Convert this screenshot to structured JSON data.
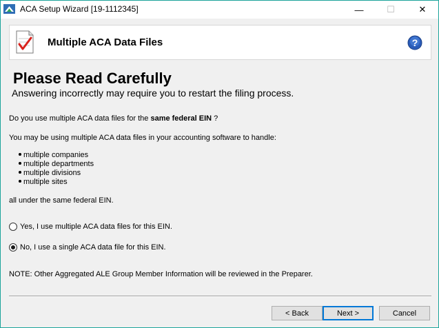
{
  "window": {
    "title": "ACA Setup Wizard [19-1112345]",
    "minimize": "—",
    "maximize": "☐",
    "close": "✕",
    "accent_color": "#1aa39a"
  },
  "header": {
    "title": "Multiple ACA Data Files",
    "icon": "checklist-icon",
    "help_icon": "help-icon"
  },
  "content": {
    "heading": "Please Read Carefully",
    "subheading": "Answering incorrectly may require you to restart the filing process.",
    "question_prefix": "Do you use multiple ACA data files for the",
    "question_bold": "same federal EIN",
    "question_suffix": "?",
    "intro": "You may be using multiple ACA data files in your accounting software to handle:",
    "list": [
      "multiple companies",
      "multiple departments",
      "multiple divisions",
      "multiple sites"
    ],
    "closing": "all under the same federal EIN.",
    "options": [
      {
        "label": "Yes, I use multiple ACA data files for this EIN.",
        "selected": false
      },
      {
        "label": "No, I use a single ACA data file for this EIN.",
        "selected": true
      }
    ],
    "note": "NOTE: Other Aggregated ALE Group Member Information will be reviewed in the Preparer."
  },
  "footer": {
    "back_label": "< Back",
    "next_label": "Next >",
    "cancel_label": "Cancel"
  }
}
